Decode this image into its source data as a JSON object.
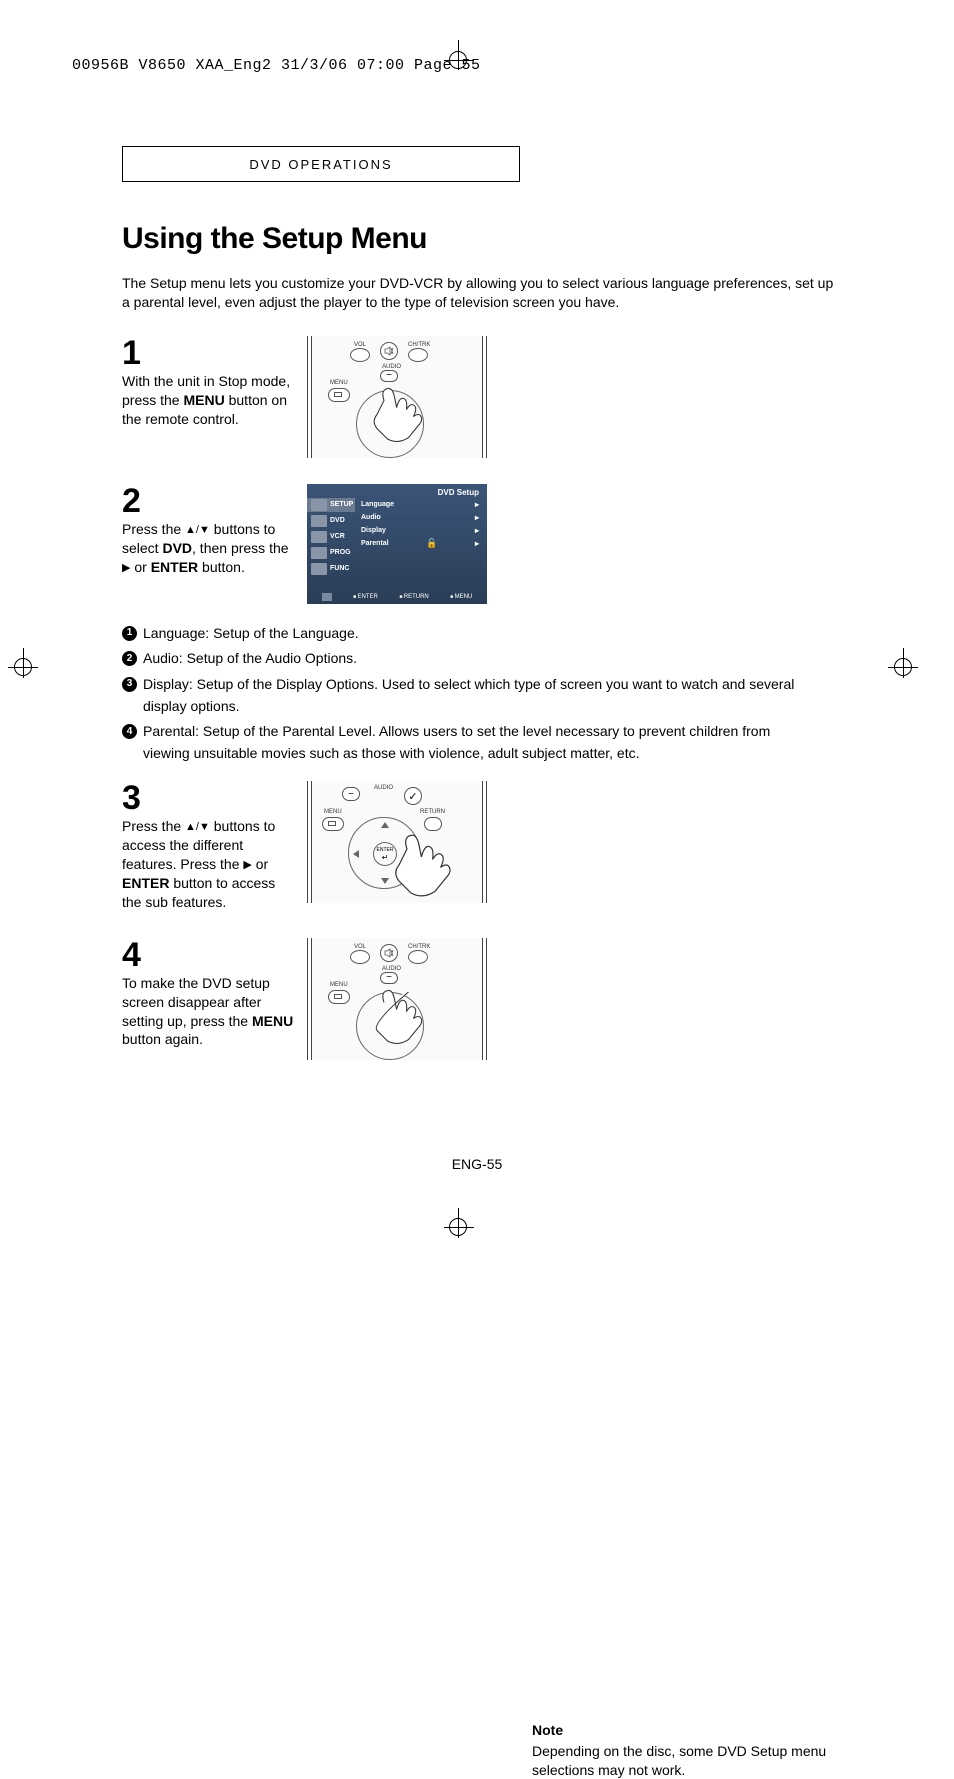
{
  "print_header": "00956B V8650 XAA_Eng2  31/3/06  07:00  Page 55",
  "section_banner": "DVD OPERATIONS",
  "title": "Using the Setup Menu",
  "intro": "The Setup menu lets you customize your DVD-VCR by allowing you to select various language preferences, set up a parental level, even adjust the player to the type of television screen you have.",
  "steps": {
    "s1": {
      "num": "1",
      "t1": "With the unit in Stop mode, press the ",
      "b1": "MENU",
      "t2": " button on the remote control."
    },
    "s2": {
      "num": "2",
      "t1": "Press the ",
      "t2": " buttons to select ",
      "b1": "DVD",
      "t3": ", then press the ",
      "t4": " or ",
      "b2": "ENTER",
      "t5": " button."
    },
    "s3": {
      "num": "3",
      "t1": "Press the ",
      "t2": " buttons to access the different features. Press the ",
      "t3": " or ",
      "b1": "ENTER",
      "t4": " button to access the sub features."
    },
    "s4": {
      "num": "4",
      "t1": "To make the DVD setup screen disappear after setting up, press the ",
      "b1": "MENU",
      "t2": " button again."
    }
  },
  "bullets": {
    "b1": "Language: Setup of the Language.",
    "b2": "Audio: Setup of the Audio Options.",
    "b3a": "Display: Setup of the Display Options. Used to select which type of screen you want to watch and several",
    "b3b": "display options.",
    "b4a": "Parental: Setup of the Parental Level. Allows users to set the level necessary to prevent children from",
    "b4b": "viewing unsuitable movies such as those with violence, adult subject matter, etc."
  },
  "osd": {
    "title": "DVD Setup",
    "side": [
      "SETUP",
      "DVD",
      "VCR",
      "PROG",
      "FUNC"
    ],
    "rows": [
      "Language",
      "Audio",
      "Display",
      "Parental"
    ],
    "footer": [
      "ENTER",
      "RETURN",
      "MENU"
    ]
  },
  "remote_labels": {
    "vol": "VOL",
    "mute": "",
    "chtrk": "CH/TRK",
    "audio": "AUDIO",
    "menu": "MENU",
    "return": "RETURN",
    "enter": "ENTER"
  },
  "note": {
    "title": "Note",
    "body": "Depending on the disc, some DVD Setup menu selections may not work."
  },
  "page_num": "ENG-55"
}
